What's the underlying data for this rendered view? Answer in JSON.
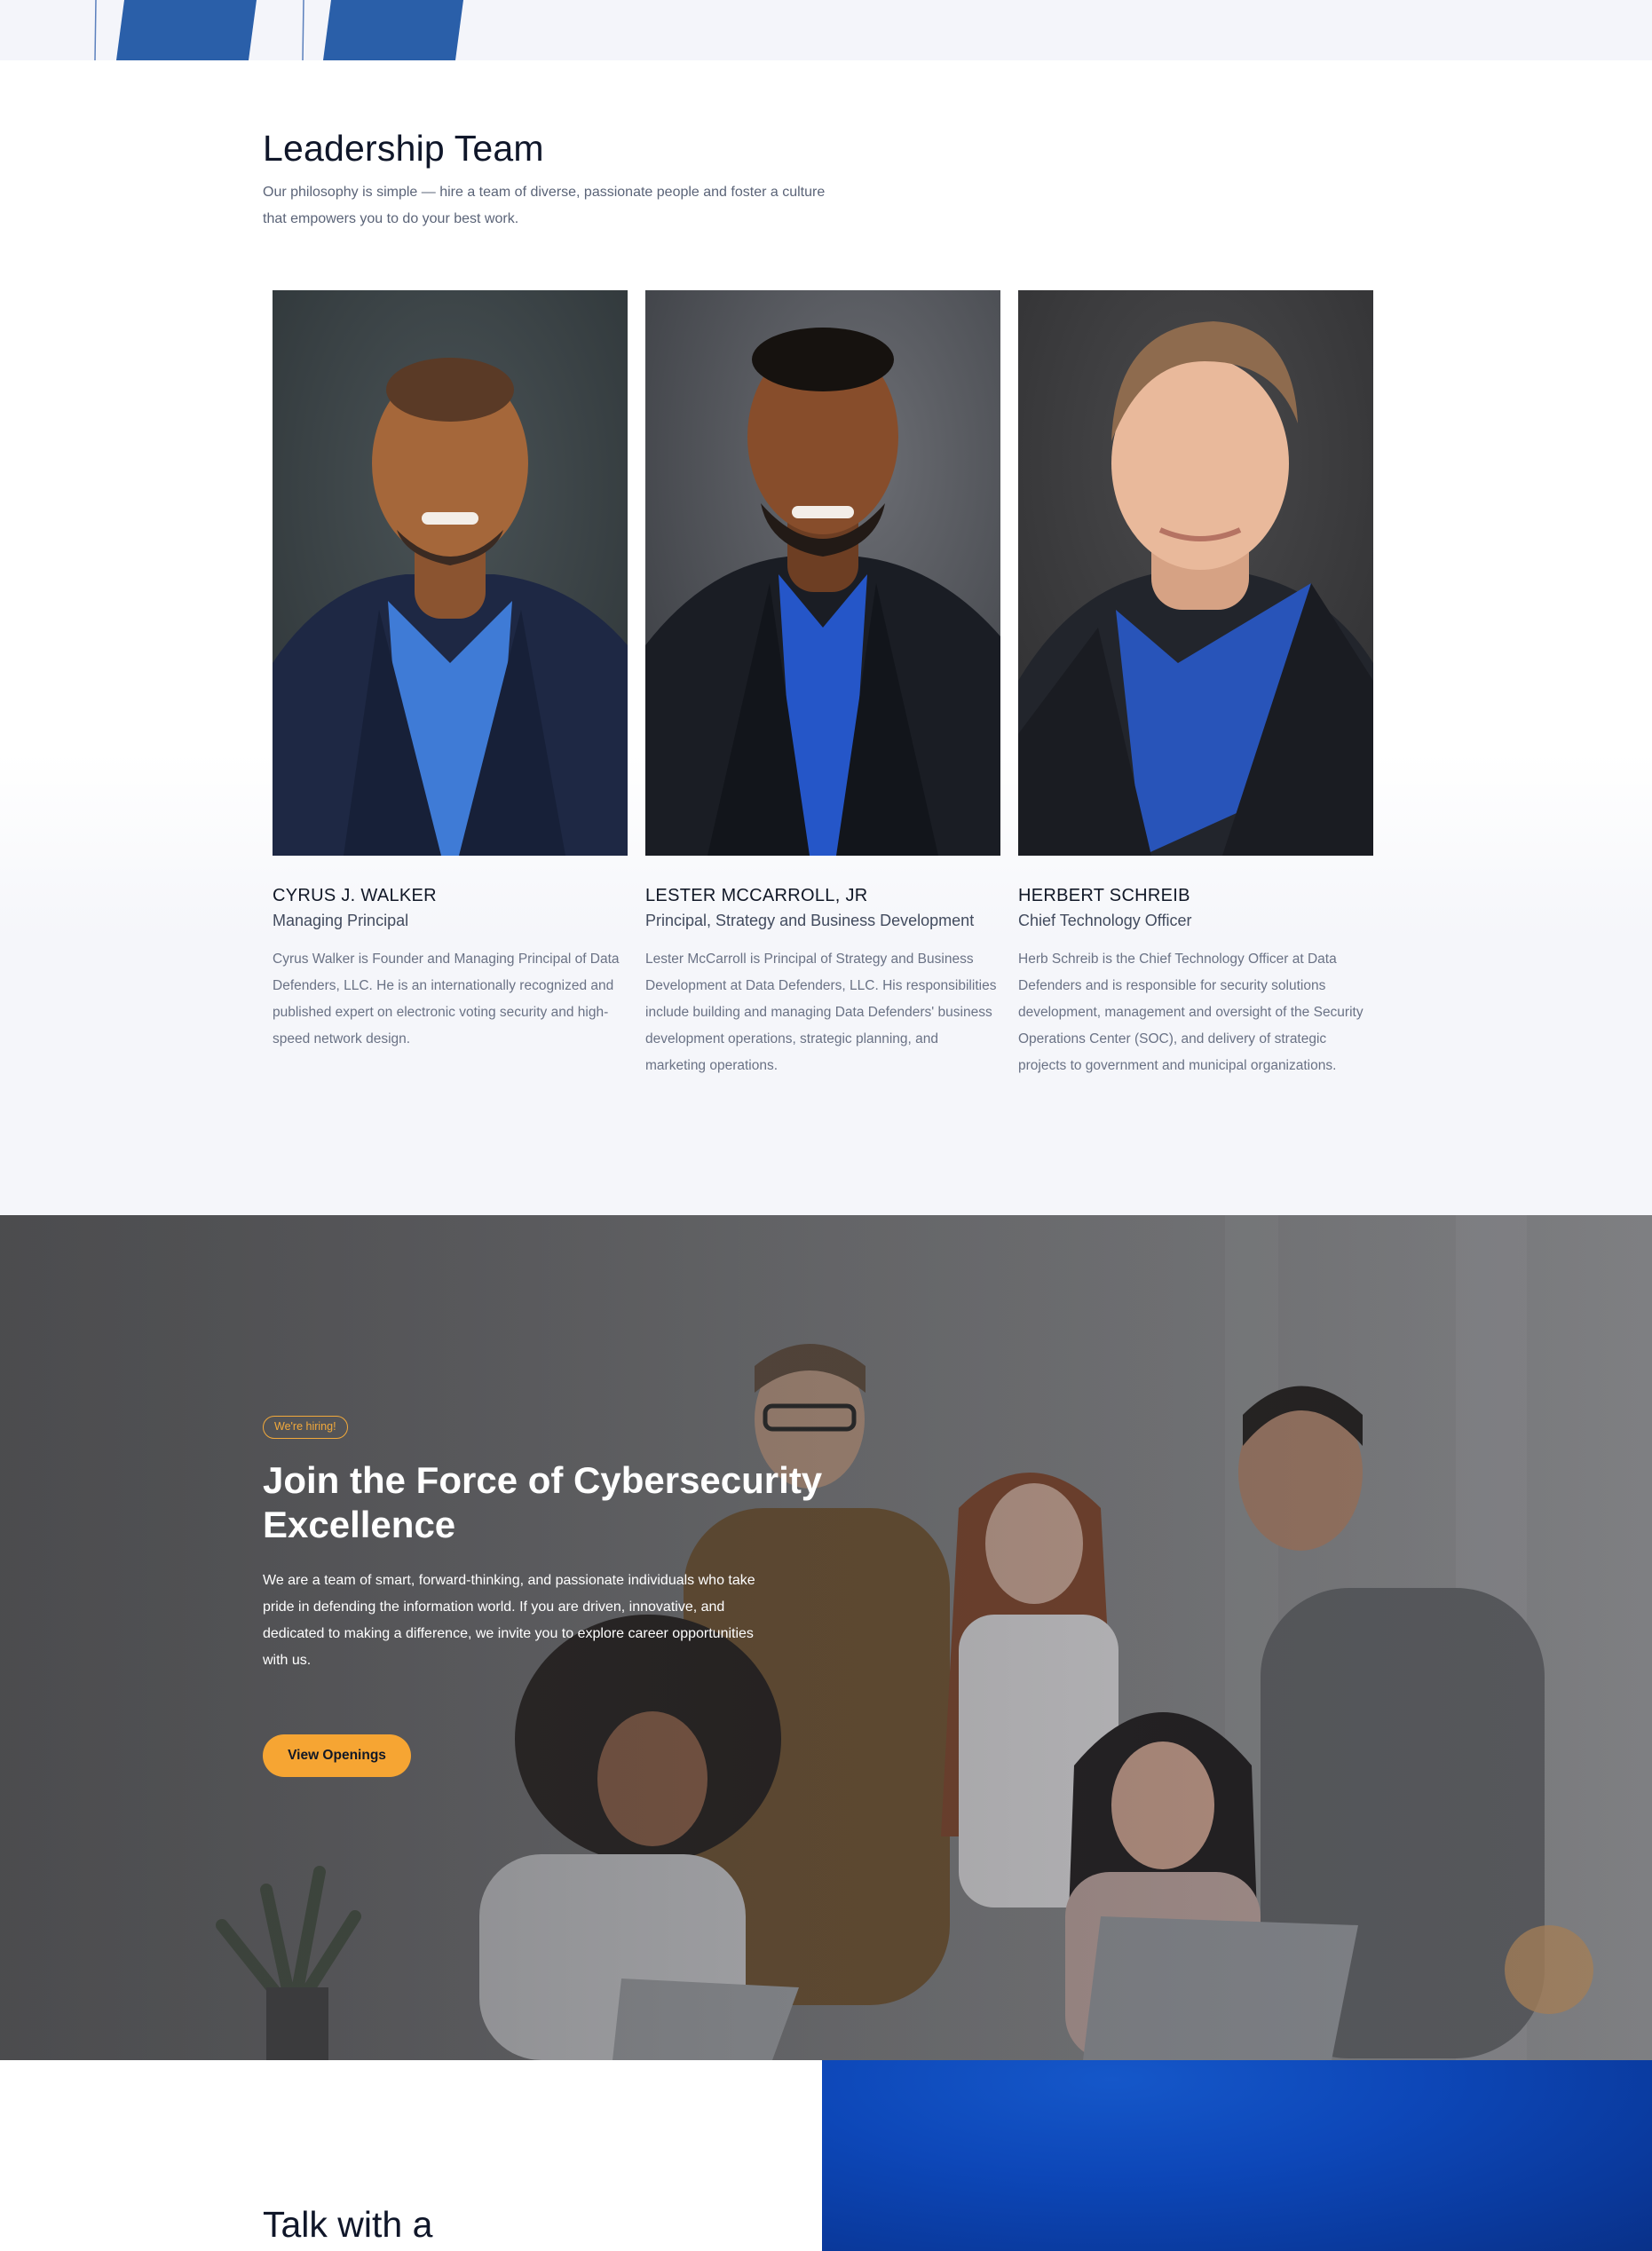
{
  "colors": {
    "accent_blue": "#2a5fa9",
    "accent_orange": "#f6a533",
    "heading": "#0f1629",
    "muted": "#6a7285"
  },
  "leadership": {
    "title": "Leadership Team",
    "intro": "Our philosophy is simple — hire a team of diverse, passionate people and foster a culture that empowers you to do your best work.",
    "members": [
      {
        "name": "CYRUS J. WALKER",
        "role": "Managing Principal",
        "bio": "Cyrus Walker is Founder and Managing Principal of Data Defenders, LLC. He is an internationally recognized and published expert on electronic voting security and high-speed network design."
      },
      {
        "name": "LESTER MCCARROLL, JR",
        "role": "Principal, Strategy and Business Development",
        "bio": "Lester McCarroll is Principal of Strategy and Business Development at Data Defenders, LLC. His responsibilities include building and managing Data Defenders' business development operations, strategic planning, and marketing operations."
      },
      {
        "name": "HERBERT SCHREIB",
        "role": "Chief Technology Officer",
        "bio": "Herb Schreib is the Chief Technology Officer at Data Defenders and is responsible for security solutions development, management and oversight of the Security Operations Center (SOC), and delivery of strategic projects to government and municipal organizations."
      }
    ]
  },
  "hiring": {
    "badge": "We're hiring!",
    "title": "Join the Force of Cybersecurity Excellence",
    "text": "We are a team of smart, forward-thinking, and passionate individuals who take pride in defending the information world. If you are driven, innovative, and dedicated to making a difference, we invite you to explore career opportunities with us.",
    "button_label": "View Openings"
  },
  "contact": {
    "title": "Talk with a"
  }
}
